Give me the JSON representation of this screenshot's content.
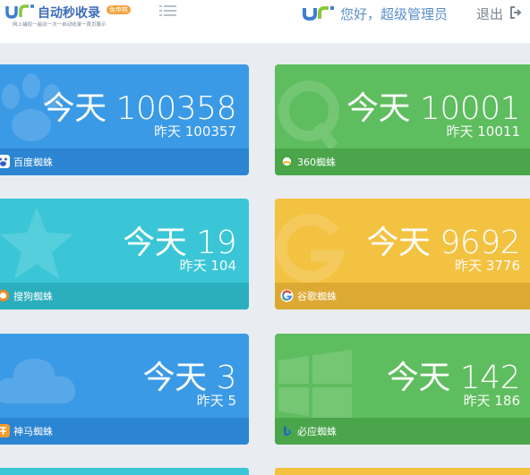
{
  "header": {
    "logo_title": "自动秒收录",
    "logo_tag": "免申核",
    "logo_slogan": "网上捕捉一遍动一次一自动收录一首页展示",
    "greeting": "您好，超级管理员",
    "logout_label": "退出"
  },
  "cards": [
    {
      "engine": "百度蜘蛛",
      "today": "今天 100358",
      "yesterday": "昨天 100357",
      "color": "#3b9ae6"
    },
    {
      "engine": "360蜘蛛",
      "today": "今天 10001",
      "yesterday": "昨天 10011",
      "color": "#5ebd5e"
    },
    {
      "engine": "搜狗蜘蛛",
      "today": "今天 19",
      "yesterday": "昨天 104",
      "color": "#3ac6d6"
    },
    {
      "engine": "谷歌蜘蛛",
      "today": "今天 9692",
      "yesterday": "昨天 3776",
      "color": "#f4c241"
    },
    {
      "engine": "神马蜘蛛",
      "today": "今天 3",
      "yesterday": "昨天 5",
      "color": "#3b9ae6"
    },
    {
      "engine": "必应蜘蛛",
      "today": "今天 142",
      "yesterday": "昨天 186",
      "color": "#5ebd5e"
    }
  ],
  "icons": {
    "brand_logo": "jr-logo-icon",
    "menu": "list-menu-icon",
    "logout": "sign-out-icon"
  }
}
